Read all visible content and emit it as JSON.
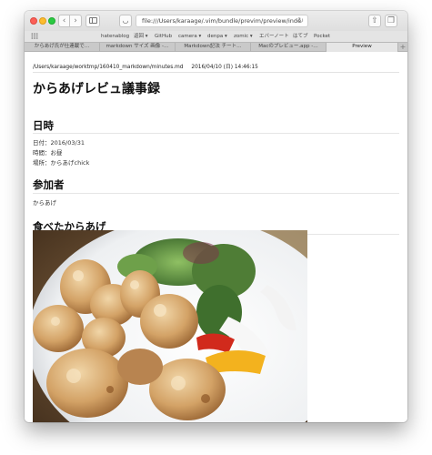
{
  "browser": {
    "url": "file:///Users/karaage/.vim/bundle/previm/preview/inde",
    "favorites": [
      "hatenablog",
      "返回 ▾",
      "GitHub",
      "camera ▾",
      "denpa ▾",
      "zomic ▾",
      "エバーノート",
      "はてブ",
      "Pocket"
    ],
    "tabs": [
      {
        "label": "からあげ氏が仕連載で…"
      },
      {
        "label": "markdown サイズ 画像 -…"
      },
      {
        "label": "Markdown記法 チート…"
      },
      {
        "label": "Macのプレビュー.app -…"
      },
      {
        "label": "Preview"
      }
    ],
    "new_tab_label": "+"
  },
  "doc": {
    "path": "/Users/karaage/worktmp/160410_markdown/minutes.md",
    "modified": "2016/04/10 (日) 14:46:15",
    "title": "からあげレビュ議事録",
    "sections": [
      {
        "heading": "日時",
        "lines": [
          "日付：2016/03/31",
          "時間：お昼",
          "場所：からあげchick"
        ]
      },
      {
        "heading": "参加者",
        "lines": [
          "からあげ"
        ]
      },
      {
        "heading": "食べたからあげ",
        "lines": []
      }
    ]
  },
  "colors": {
    "close": "#fc5f57",
    "minimize": "#fdbc2e",
    "maximize": "#29c941"
  },
  "icons": {
    "back": "chevron-left-icon",
    "forward": "chevron-right-icon",
    "sidebar": "sidebar-icon",
    "pocket": "pocket-icon",
    "reload": "reload-icon",
    "share": "share-icon",
    "tabs": "tabs-overview-icon",
    "favorites": "grid-icon"
  }
}
